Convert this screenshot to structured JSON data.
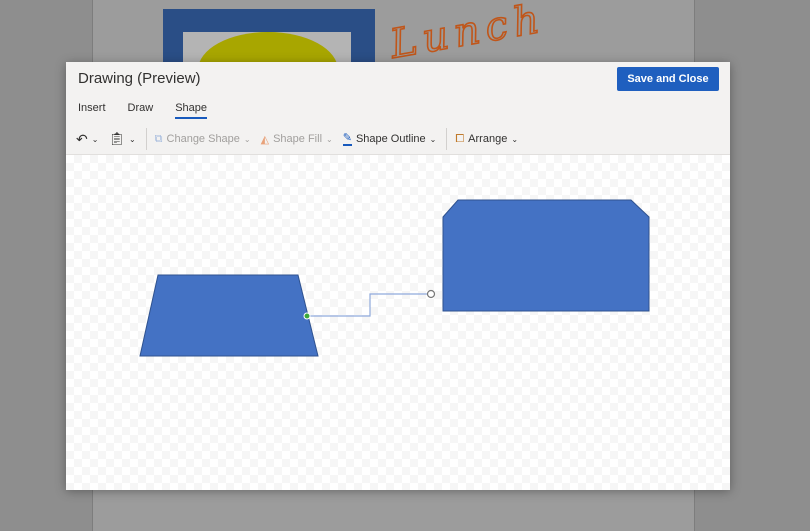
{
  "background_document": {
    "ink_text": "Lunch"
  },
  "dialog": {
    "title": "Drawing (Preview)",
    "save_label": "Save and Close",
    "tabs": [
      {
        "label": "Insert",
        "active": false
      },
      {
        "label": "Draw",
        "active": false
      },
      {
        "label": "Shape",
        "active": true
      }
    ],
    "toolbar": {
      "change_shape": "Change Shape",
      "shape_fill": "Shape Fill",
      "shape_outline": "Shape Outline",
      "arrange": "Arrange"
    }
  },
  "colors": {
    "accent": "#1f5fbf",
    "shape_fill": "#4472c4",
    "shape_stroke": "#2f528f",
    "connector": "#8faadc"
  }
}
